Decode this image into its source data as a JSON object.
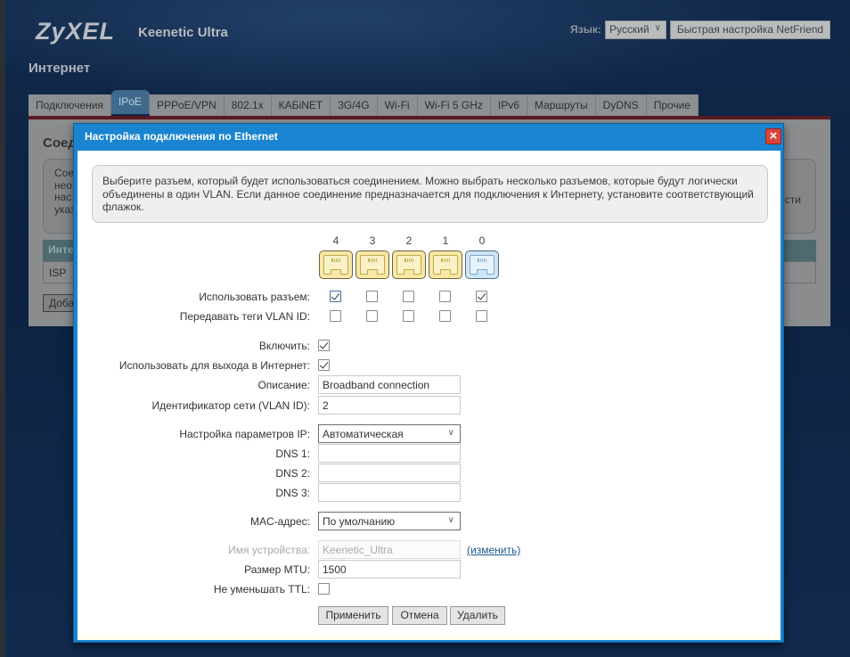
{
  "header": {
    "brand": "ZyXEL",
    "model": "Keenetic Ultra",
    "language_label": "Язык:",
    "language_value": "Русский",
    "netfriend_button": "Быстрая настройка NetFriend"
  },
  "page_title": "Интернет",
  "tabs": [
    {
      "label": "Подключения",
      "active": false
    },
    {
      "label": "IPoE",
      "active": true
    },
    {
      "label": "PPPoE/VPN",
      "active": false
    },
    {
      "label": "802.1x",
      "active": false
    },
    {
      "label": "КАБiNET",
      "active": false
    },
    {
      "label": "3G/4G",
      "active": false
    },
    {
      "label": "Wi-Fi",
      "active": false
    },
    {
      "label": "Wi-Fi 5 GHz",
      "active": false
    },
    {
      "label": "IPv6",
      "active": false
    },
    {
      "label": "Маршруты",
      "active": false
    },
    {
      "label": "DyDNS",
      "active": false
    },
    {
      "label": "Прочие",
      "active": false
    }
  ],
  "background_panel": {
    "heading": "Соед",
    "note_lines": [
      "Сое",
      "нео",
      "нас",
      "указ"
    ],
    "note_tail": "сти",
    "table_header": "Инте",
    "table_row": "ISP",
    "add_button": "Доба"
  },
  "dialog": {
    "title": "Настройка подключения по Ethernet",
    "close_icon": "close-icon",
    "info_text": "Выберите разъем, который будет использоваться соединением. Можно выбрать несколько разъемов, которые будут логически объединены в один VLAN. Если данное соединение предназначается для подключения к Интернету, установите соответствующий флажок.",
    "ports": [
      {
        "number": "4",
        "type": "lan",
        "use": true,
        "vlan_tags": false
      },
      {
        "number": "3",
        "type": "lan",
        "use": false,
        "vlan_tags": false
      },
      {
        "number": "2",
        "type": "lan",
        "use": false,
        "vlan_tags": false
      },
      {
        "number": "1",
        "type": "lan",
        "use": false,
        "vlan_tags": false
      },
      {
        "number": "0",
        "type": "wan",
        "use": true,
        "vlan_tags": false
      }
    ],
    "labels": {
      "use_port": "Использовать разъем:",
      "vlan_tags": "Передавать теги VLAN ID:",
      "enable": "Включить:",
      "use_for_internet": "Использовать для выхода в Интернет:",
      "description": "Описание:",
      "vlan_id": "Идентификатор сети (VLAN ID):",
      "ip_settings": "Настройка параметров IP:",
      "dns1": "DNS 1:",
      "dns2": "DNS 2:",
      "dns3": "DNS 3:",
      "mac": "MAC-адрес:",
      "device_name": "Имя устройства:",
      "mtu": "Размер MTU:",
      "no_ttl_decrement": "Не уменьшать TTL:"
    },
    "values": {
      "enable": true,
      "use_for_internet": true,
      "description": "Broadband connection",
      "vlan_id": "2",
      "ip_settings": "Автоматическая",
      "dns1": "",
      "dns2": "",
      "dns3": "",
      "mac": "По умолчанию",
      "device_name": "Keenetic_Ultra",
      "mtu": "1500",
      "no_ttl_decrement": false
    },
    "change_link": "(изменить)",
    "buttons": {
      "apply": "Применить",
      "cancel": "Отмена",
      "delete": "Удалить"
    }
  }
}
